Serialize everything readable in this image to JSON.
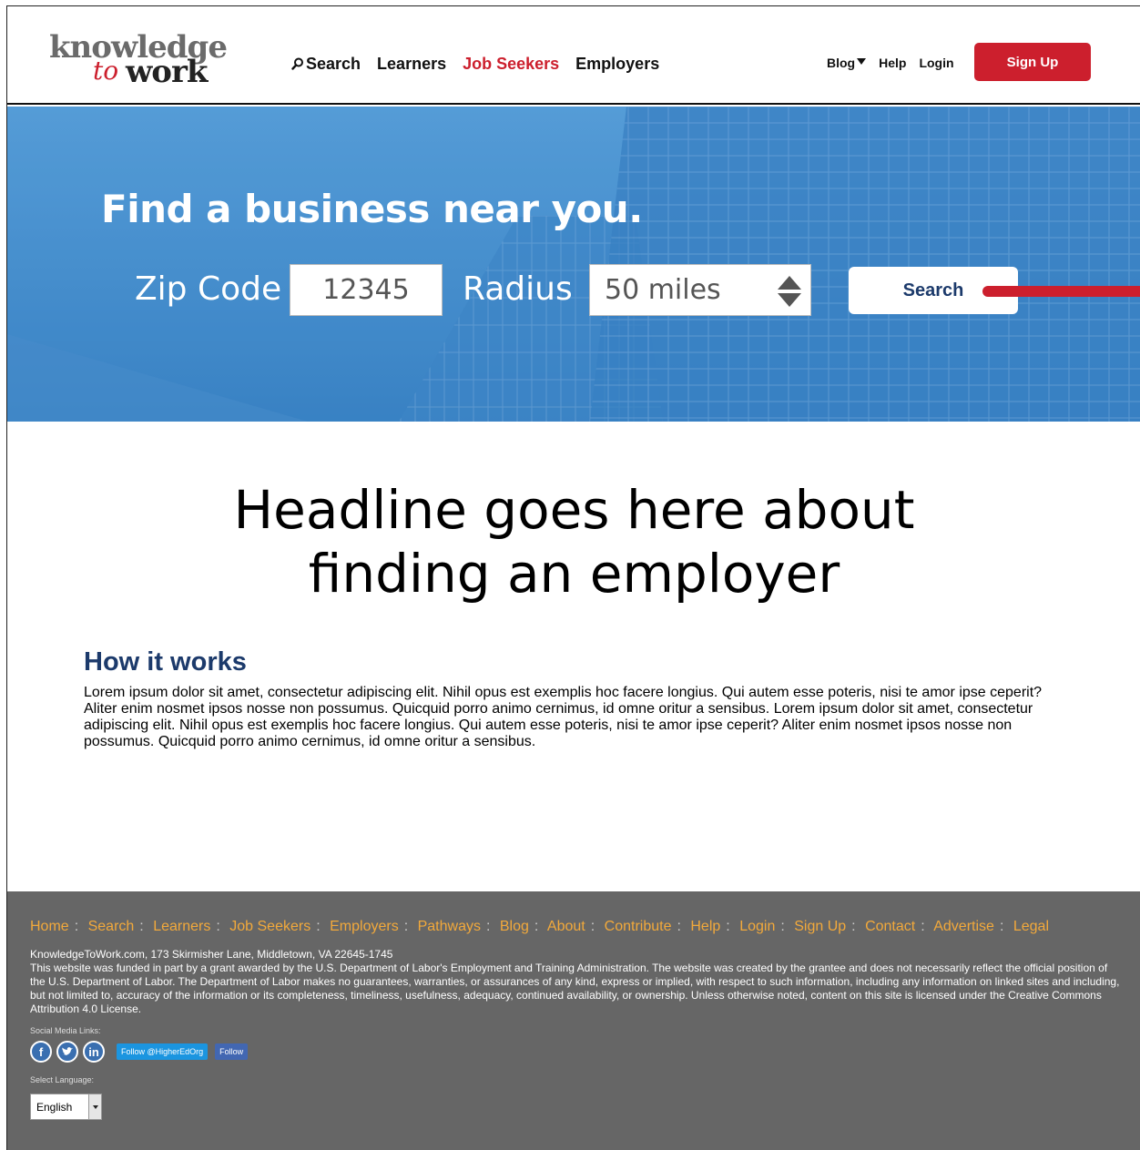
{
  "header": {
    "logo": {
      "line1": "knowledge",
      "line2": "to",
      "line3": "work"
    },
    "nav": [
      {
        "label": "Search"
      },
      {
        "label": "Learners"
      },
      {
        "label": "Job Seekers",
        "active": true
      },
      {
        "label": "Employers"
      }
    ],
    "right_nav": {
      "blog": "Blog",
      "help": "Help",
      "login": "Login"
    },
    "signup_label": "Sign Up"
  },
  "hero": {
    "title": "Find a business near you.",
    "zip_label": "Zip Code",
    "zip_value": "12345",
    "radius_label": "Radius",
    "radius_value": "50 miles",
    "search_label": "Search"
  },
  "main": {
    "headline_line1": "Headline goes here about",
    "headline_line2": "finding an employer",
    "section_title": "How it works",
    "body": "Lorem ipsum dolor sit amet, consectetur adipiscing elit. Nihil opus est exemplis hoc facere longius. Qui autem esse poteris, nisi te amor ipse ceperit? Aliter enim nosmet ipsos nosse non possumus. Quicquid porro animo cernimus, id omne oritur a sensibus. Lorem ipsum dolor sit amet, consectetur adipiscing elit. Nihil opus est exemplis hoc facere longius. Qui autem esse poteris, nisi te amor ipse ceperit? Aliter enim nosmet ipsos nosse non possumus. Quicquid porro animo cernimus, id omne oritur a sensibus."
  },
  "footer": {
    "links": [
      "Home",
      "Search",
      "Learners",
      "Job Seekers",
      "Employers",
      "Pathways",
      "Blog",
      "About",
      "Contribute",
      "Help",
      "Login",
      "Sign Up",
      "Contact",
      "Advertise",
      "Legal"
    ],
    "address": "KnowledgeToWork.com, 173 Skirmisher Lane, Middletown, VA 22645-1745",
    "disclaimer": "This website was funded in part by a grant awarded by the U.S. Department of Labor's Employment and Training Administration. The website was created by the grantee and does not necessarily reflect the official position of the U.S. Department of Labor. The Department of Labor makes no guarantees, warranties, or assurances of any kind, express or implied, with respect to such information, including any information on linked sites and including, but not limited to, accuracy of the information or its completeness, timeliness, usefulness, adequacy, continued availability, or ownership. Unless otherwise noted, content on this site is licensed under the Creative Commons Attribution 4.0 License.",
    "social_label": "Social Media Links:",
    "social_icons": [
      "facebook-icon",
      "twitter-icon",
      "linkedin-icon"
    ],
    "twitter_follow": "Follow @HigherEdOrg",
    "facebook_follow": "Follow",
    "language_label": "Select Language:",
    "language_value": "English"
  },
  "colors": {
    "brand_red": "#cc1f2d",
    "navy": "#1c3a6b",
    "footer_bg": "#666666",
    "footer_link": "#f2a93b",
    "hero_blue": "#4a93d2"
  }
}
